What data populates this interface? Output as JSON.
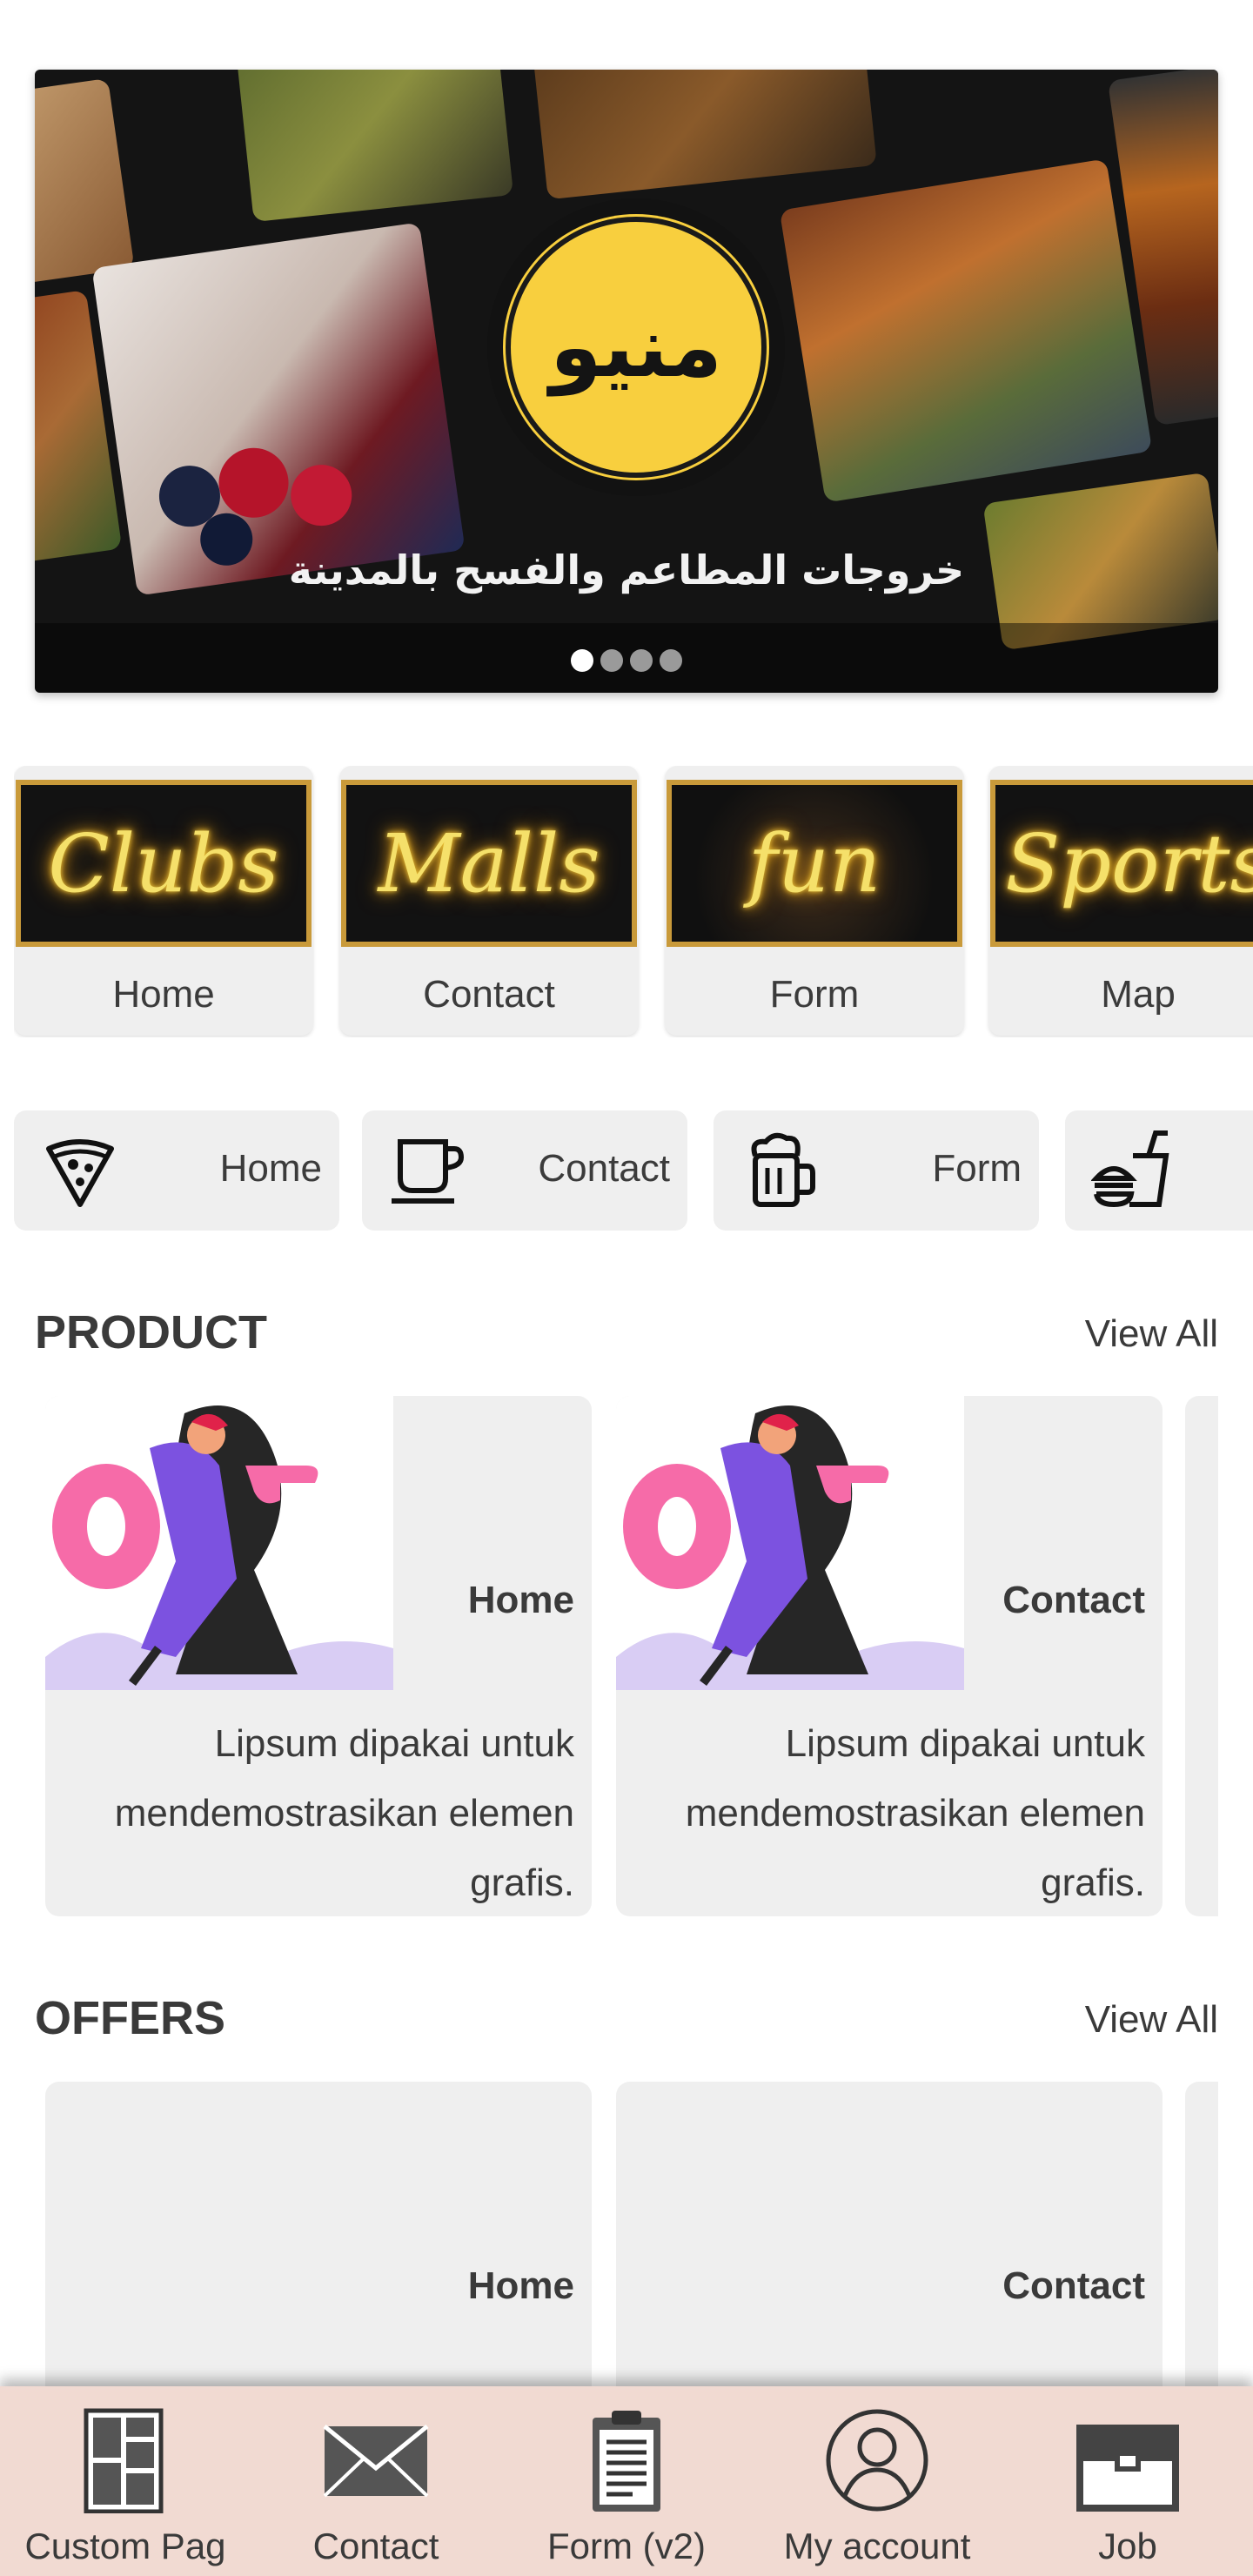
{
  "banner": {
    "logo_text": "منيو",
    "caption": "خروجات المطاعم والفسح بالمدينة",
    "slides_total": 4,
    "active_slide": 1
  },
  "categories": [
    {
      "neon": "Clubs",
      "label": "Home"
    },
    {
      "neon": "Malls",
      "label": "Contact"
    },
    {
      "neon": "fun",
      "label": "Form"
    },
    {
      "neon": "Sports",
      "label": "Map"
    }
  ],
  "chips": [
    {
      "icon": "pizza-icon",
      "label": "Home"
    },
    {
      "icon": "coffee-cup-icon",
      "label": "Contact"
    },
    {
      "icon": "beer-mug-icon",
      "label": "Form"
    },
    {
      "icon": "fast-food-icon",
      "label": ""
    }
  ],
  "product": {
    "title": "PRODUCT",
    "view_all": "View All",
    "items": [
      {
        "title": "Home",
        "desc": "Lipsum dipakai untuk mendemostrasikan elemen grafis."
      },
      {
        "title": "Contact",
        "desc": "Lipsum dipakai untuk mendemostrasikan elemen grafis."
      }
    ]
  },
  "offers": {
    "title": "OFFERS",
    "view_all": "View All",
    "items": [
      {
        "title": "Home"
      },
      {
        "title": "Contact"
      }
    ]
  },
  "bottom_nav": [
    {
      "icon": "layout-icon",
      "label": "Custom Pag"
    },
    {
      "icon": "envelope-icon",
      "label": "Contact"
    },
    {
      "icon": "clipboard-icon",
      "label": "Form (v2)"
    },
    {
      "icon": "user-icon",
      "label": "My account"
    },
    {
      "icon": "briefcase-icon",
      "label": "Job"
    }
  ],
  "colors": {
    "accent_gold": "#f8cf3e",
    "neon_yellow": "#f5e06a",
    "card_bg": "#efefef",
    "nav_bg": "#f1dad2"
  }
}
